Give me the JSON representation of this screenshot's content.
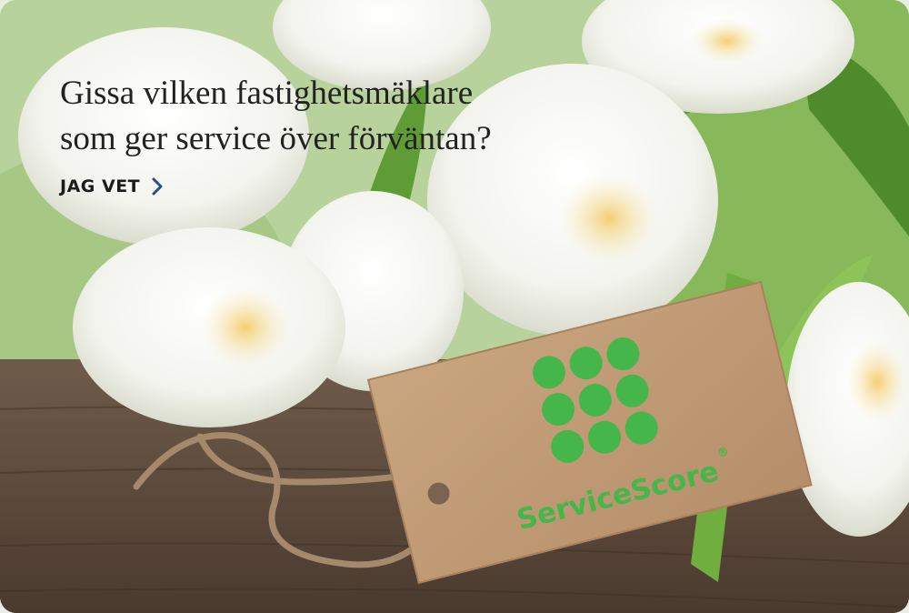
{
  "headline": {
    "line1": "Gissa vilken fastighetsmäklare",
    "line2": "som ger service över förväntan?"
  },
  "cta": {
    "label": "JAG VET",
    "icon": "chevron-right-icon",
    "chevron_color": "#2a4c8a"
  },
  "tag": {
    "brand": "ServiceScore",
    "registered": "®",
    "brand_color": "#45b649"
  }
}
